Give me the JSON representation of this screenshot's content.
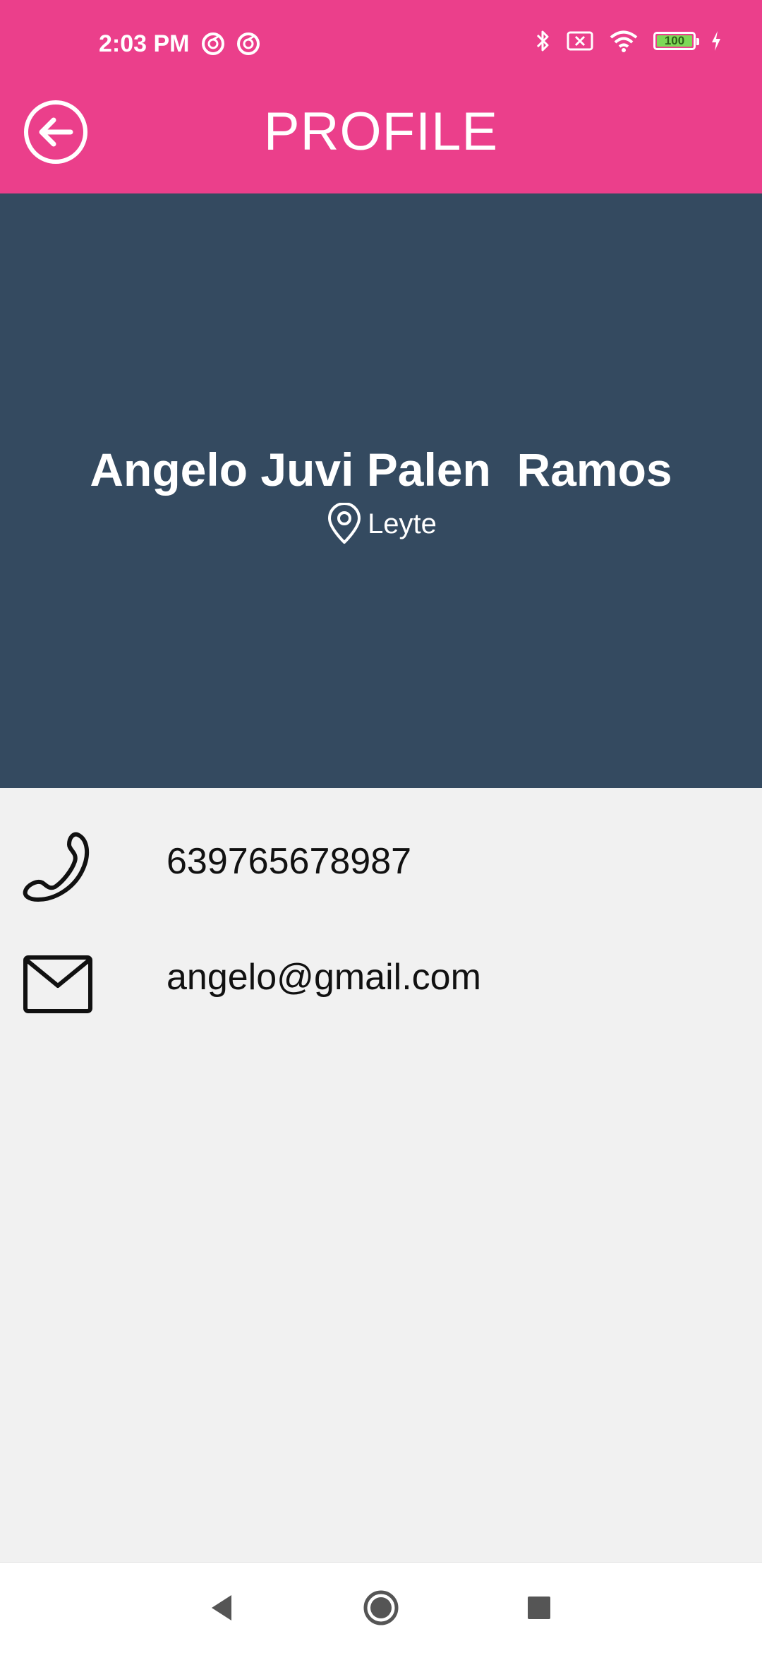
{
  "status_bar": {
    "time": "2:03 PM",
    "battery_level": "100",
    "icons": [
      "app-notification-icon",
      "app-notification-icon",
      "bluetooth-icon",
      "sim-off-icon",
      "wifi-icon",
      "battery-icon",
      "charging-icon"
    ]
  },
  "app_bar": {
    "title": "PROFILE",
    "back_icon": "back-arrow-circle-icon",
    "color": "#eb3f8b"
  },
  "profile": {
    "name": "Angelo Juvi Palen  Ramos",
    "location": "Leyte",
    "location_icon": "location-pin-icon",
    "header_color": "#344a60"
  },
  "contact": {
    "phone": "639765678987",
    "phone_icon": "phone-icon",
    "email": "angelo@gmail.com",
    "email_icon": "mail-icon"
  },
  "nav_bar": {
    "buttons": [
      "back-icon",
      "home-icon",
      "recents-icon"
    ]
  }
}
